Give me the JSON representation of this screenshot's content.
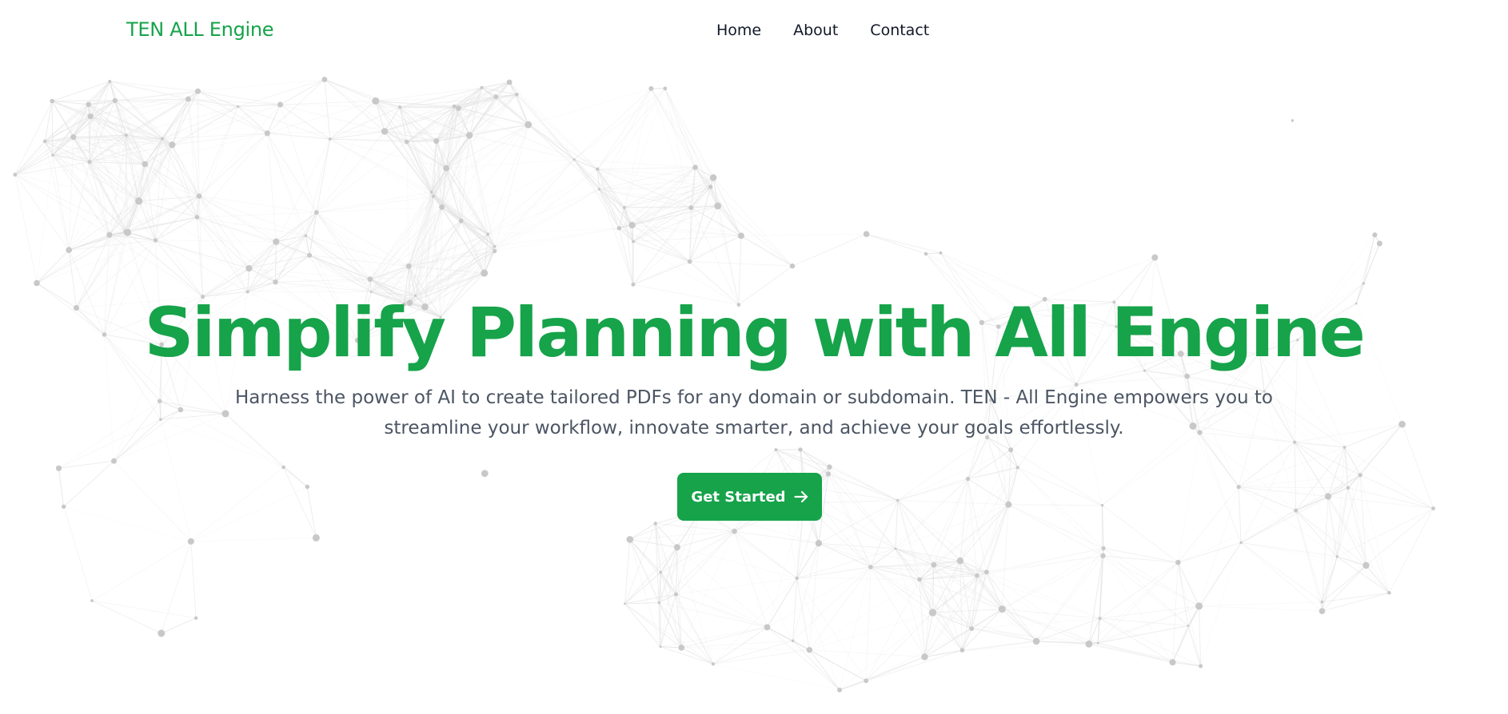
{
  "header": {
    "brand": "TEN ALL Engine",
    "nav": [
      {
        "label": "Home"
      },
      {
        "label": "About"
      },
      {
        "label": "Contact"
      }
    ]
  },
  "hero": {
    "title": "Simplify Planning with All Engine",
    "subtitle": "Harness the power of AI to create tailored PDFs for any domain or subdomain. TEN - All Engine empowers you to streamline your workflow, innovate smarter, and achieve your goals effortlessly.",
    "cta_label": "Get Started",
    "cta_icon": "arrow-right-icon"
  },
  "colors": {
    "accent": "#16a34a",
    "nav_text": "#111827",
    "body_text": "#4b5563",
    "network_node": "#c8c8c8",
    "network_line": "#e2e2e2"
  },
  "background": {
    "effect": "particle-network"
  }
}
